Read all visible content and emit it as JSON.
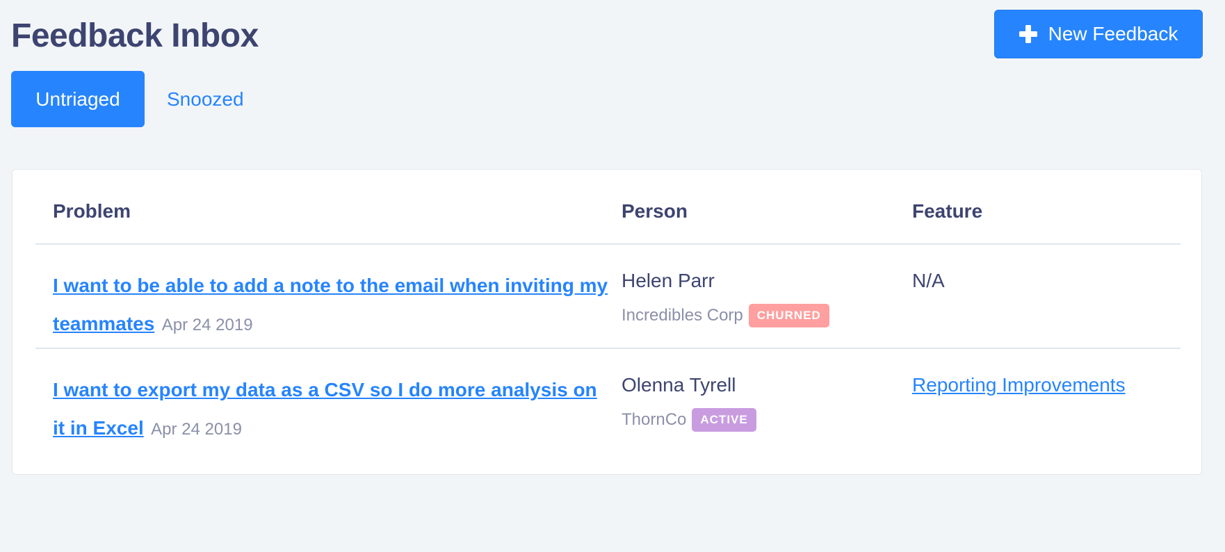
{
  "header": {
    "title": "Feedback Inbox",
    "new_button_label": "New Feedback",
    "new_button_icon": "plus-icon"
  },
  "tabs": [
    {
      "label": "Untriaged",
      "active": true
    },
    {
      "label": "Snoozed",
      "active": false
    }
  ],
  "table": {
    "columns": [
      "Problem",
      "Person",
      "Feature"
    ],
    "rows": [
      {
        "problem": "I want to be able to add a note to the email when inviting my teammates",
        "date": "Apr 24 2019",
        "person": "Helen Parr",
        "company": "Incredibles Corp",
        "status": "CHURNED",
        "feature": "N/A"
      },
      {
        "problem": "I want to export my data as a CSV so I do more analysis on it in Excel",
        "date": "Apr 24 2019",
        "person": "Olenna Tyrell",
        "company": "ThornCo",
        "status": "ACTIVE",
        "feature": "Reporting Improvements"
      }
    ]
  },
  "colors": {
    "accent": "#2684ff",
    "title_text": "#3d4470",
    "muted_text": "#8a90a8",
    "background": "#f2f5f8",
    "churned_badge": "#ff9f9f",
    "active_badge": "#c99ce0"
  }
}
